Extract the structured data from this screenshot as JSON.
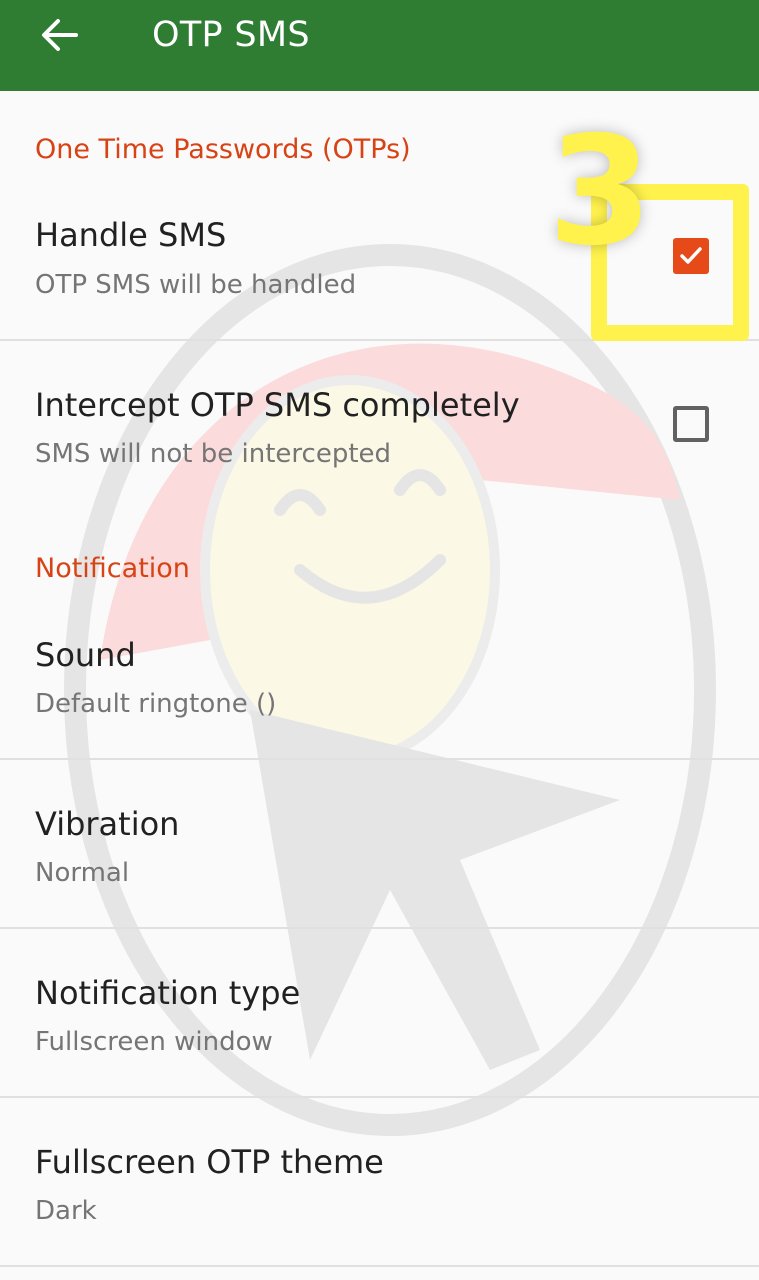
{
  "app_bar": {
    "title": "OTP SMS",
    "back_icon": "arrow-back-icon",
    "color": "#2e7d32"
  },
  "sections": {
    "otps": {
      "header": "One Time Passwords (OTPs)",
      "handle_sms": {
        "title": "Handle SMS",
        "summary": "OTP SMS will be handled",
        "checked": true
      },
      "intercept": {
        "title": "Intercept OTP SMS completely",
        "summary": "SMS will not be intercepted",
        "checked": false
      }
    },
    "notification": {
      "header": "Notification",
      "sound": {
        "title": "Sound",
        "summary": "Default ringtone ()"
      },
      "vibration": {
        "title": "Vibration",
        "summary": "Normal"
      },
      "type": {
        "title": "Notification type",
        "summary": "Fullscreen window"
      },
      "theme": {
        "title": "Fullscreen OTP theme",
        "summary": "Dark"
      }
    }
  },
  "annotation": {
    "step_number": "3",
    "color": "#fff24d"
  },
  "colors": {
    "accent": "#e64a19",
    "section_header": "#d84315"
  }
}
